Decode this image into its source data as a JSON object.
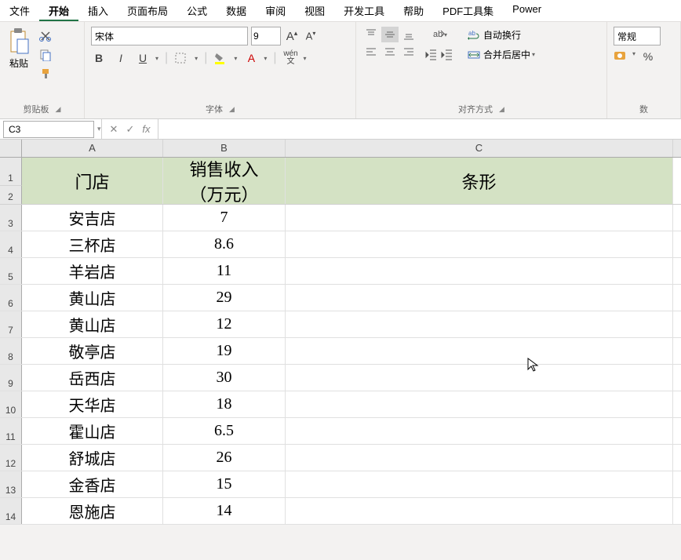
{
  "menubar": {
    "items": [
      "文件",
      "开始",
      "插入",
      "页面布局",
      "公式",
      "数据",
      "审阅",
      "视图",
      "开发工具",
      "帮助",
      "PDF工具集",
      "Power "
    ],
    "active_index": 1
  },
  "ribbon": {
    "clipboard": {
      "paste": "粘贴",
      "label": "剪贴板"
    },
    "font": {
      "name": "宋体",
      "size": "9",
      "label": "字体",
      "pinyin": "wén"
    },
    "alignment": {
      "wrap": "自动换行",
      "merge": "合并后居中",
      "label": "对齐方式"
    },
    "number": {
      "format": "常规",
      "label": "数"
    }
  },
  "formulaBar": {
    "cellRef": "C3",
    "formula": ""
  },
  "sheet": {
    "columns": [
      "A",
      "B",
      "C"
    ],
    "headers": {
      "a": "门店",
      "b1": "销售收入",
      "b2": "（万元）",
      "c": "条形"
    },
    "rows": [
      {
        "n": 3,
        "store": "安吉店",
        "sales": "7"
      },
      {
        "n": 4,
        "store": "三杯店",
        "sales": "8.6"
      },
      {
        "n": 5,
        "store": "羊岩店",
        "sales": "11"
      },
      {
        "n": 6,
        "store": "黄山店",
        "sales": "29"
      },
      {
        "n": 7,
        "store": "黄山店",
        "sales": "12"
      },
      {
        "n": 8,
        "store": "敬亭店",
        "sales": "19"
      },
      {
        "n": 9,
        "store": "岳西店",
        "sales": "30"
      },
      {
        "n": 10,
        "store": "天华店",
        "sales": "18"
      },
      {
        "n": 11,
        "store": "霍山店",
        "sales": "6.5"
      },
      {
        "n": 12,
        "store": "舒城店",
        "sales": "26"
      },
      {
        "n": 13,
        "store": "金香店",
        "sales": "15"
      },
      {
        "n": 14,
        "store": "恩施店",
        "sales": "14"
      }
    ]
  }
}
